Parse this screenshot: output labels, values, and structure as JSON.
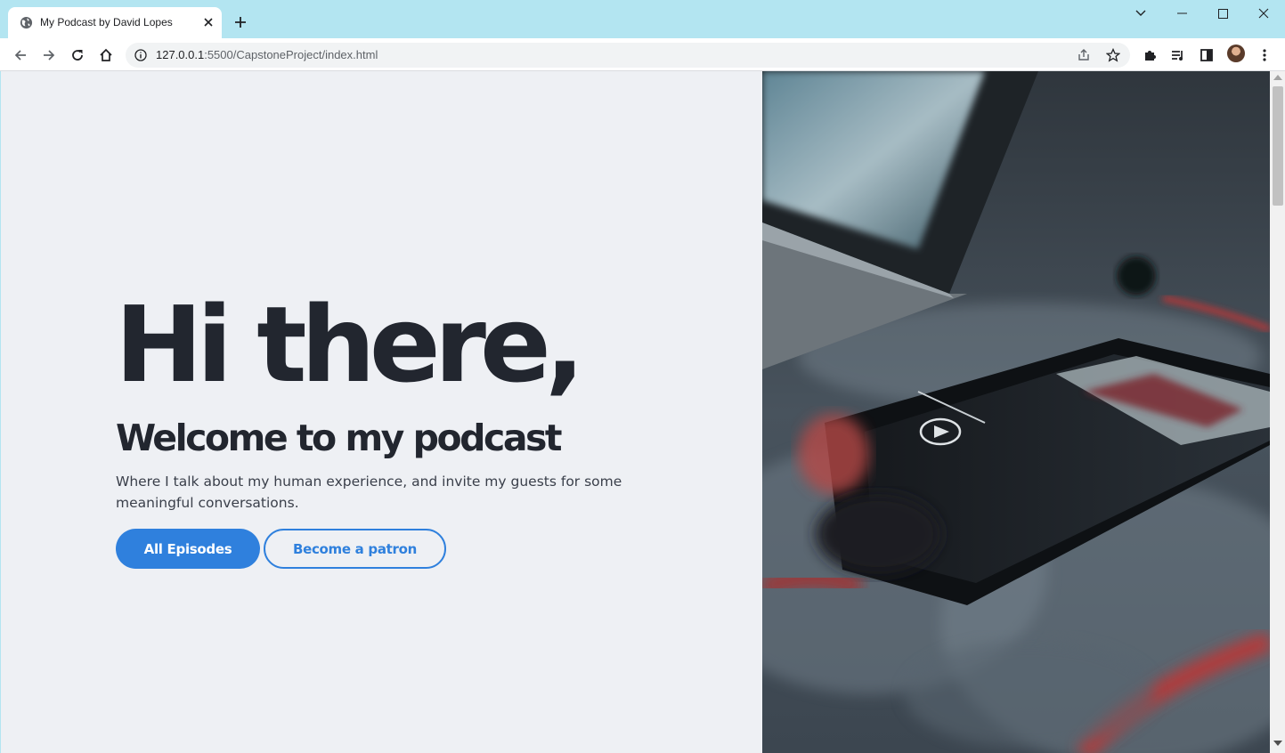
{
  "browser": {
    "tab_title": "My Podcast by David Lopes",
    "url_host": "127.0.0.1",
    "url_rest": ":5500/CapstoneProject/index.html"
  },
  "hero": {
    "title": "Hi there,",
    "subtitle": "Welcome to my podcast",
    "description": "Where I talk about my human experience, and invite my guests for some meaningful conversations.",
    "primary_button": "All Episodes",
    "secondary_button": "Become a patron"
  },
  "colors": {
    "accent": "#2f80dd",
    "heading": "#22262f",
    "page_bg": "#eef0f4",
    "frame_bg": "#b3e5f1"
  },
  "icons": [
    "globe-icon",
    "close-icon",
    "plus-icon",
    "chevron-down-icon",
    "minimize-icon",
    "maximize-icon",
    "window-close-icon",
    "back-arrow-icon",
    "forward-arrow-icon",
    "reload-icon",
    "home-icon",
    "info-icon",
    "share-icon",
    "star-icon",
    "puzzle-icon",
    "media-icon",
    "sidepanel-icon",
    "more-icon"
  ]
}
